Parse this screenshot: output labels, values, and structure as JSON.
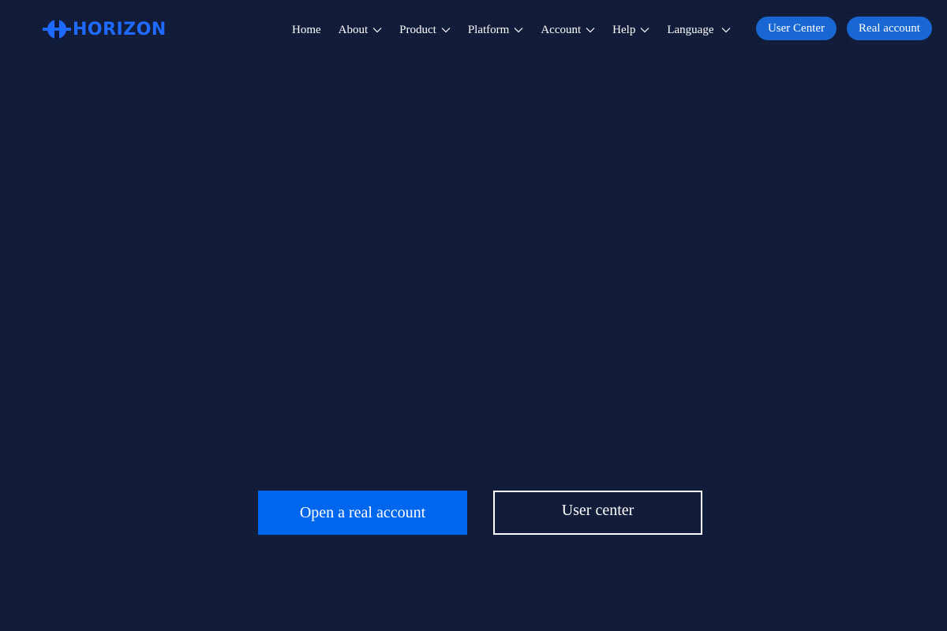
{
  "brand": {
    "name": "HORIZON",
    "color": "#1f6bff"
  },
  "nav": {
    "items": [
      {
        "label": "Home",
        "has_dropdown": false
      },
      {
        "label": "About",
        "has_dropdown": true
      },
      {
        "label": "Product",
        "has_dropdown": true
      },
      {
        "label": "Platform",
        "has_dropdown": true
      },
      {
        "label": "Account",
        "has_dropdown": true
      },
      {
        "label": "Help",
        "has_dropdown": true
      },
      {
        "label": "Language",
        "has_dropdown": true
      }
    ]
  },
  "header_buttons": {
    "user_center": "User Center",
    "real_account": "Real account",
    "color": "#1967d2"
  },
  "hero": {
    "primary_cta": "Open a real account",
    "secondary_cta": "User center",
    "primary_color": "#0066ee"
  },
  "colors": {
    "background": "#0f1a3a"
  }
}
